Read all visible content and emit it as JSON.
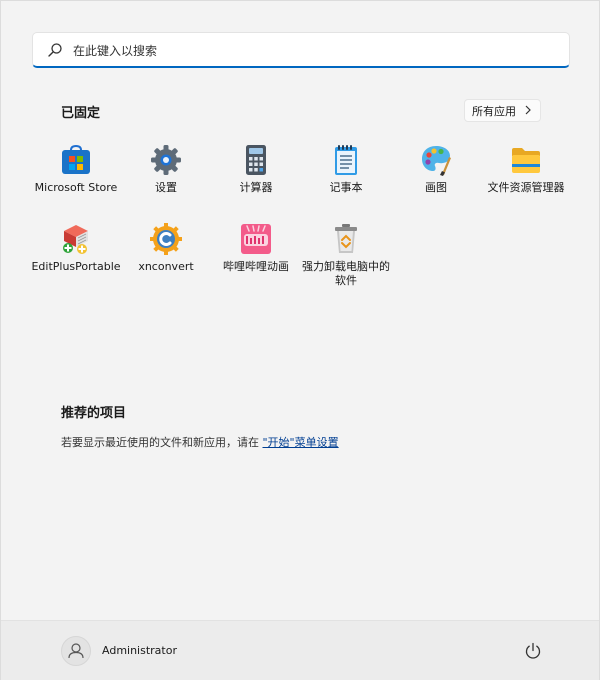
{
  "search": {
    "placeholder": "在此键入以搜索"
  },
  "pinned": {
    "title": "已固定",
    "all_apps_label": "所有应用",
    "apps": [
      {
        "label": "Microsoft Store",
        "icon": "microsoft-store-icon"
      },
      {
        "label": "设置",
        "icon": "settings-gear-icon"
      },
      {
        "label": "计算器",
        "icon": "calculator-icon"
      },
      {
        "label": "记事本",
        "icon": "notepad-icon"
      },
      {
        "label": "画图",
        "icon": "paint-palette-icon"
      },
      {
        "label": "文件资源管理器",
        "icon": "folder-icon"
      },
      {
        "label": "EditPlusPortable",
        "icon": "editplus-icon"
      },
      {
        "label": "xnconvert",
        "icon": "xnconvert-icon"
      },
      {
        "label": "哔哩哔哩动画",
        "icon": "bilibili-icon"
      },
      {
        "label": "强力卸载电脑中的软件",
        "icon": "uninstaller-icon"
      }
    ]
  },
  "recommended": {
    "title": "推荐的项目",
    "text_prefix": "若要显示最近使用的文件和新应用，请在 ",
    "link_text": "\"开始\"菜单设置"
  },
  "footer": {
    "user_name": "Administrator"
  },
  "colors": {
    "accent": "#0067c0",
    "background": "#f3f3f3",
    "link": "#003e92"
  }
}
